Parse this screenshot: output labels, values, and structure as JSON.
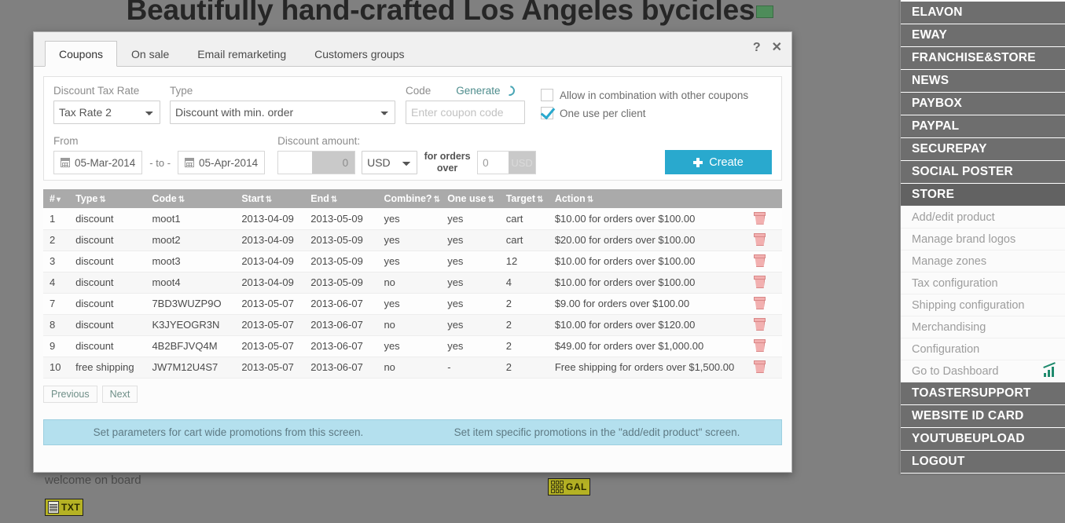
{
  "background": {
    "site_title": "Beautifully hand-crafted Los Angeles bycicles",
    "welcome_text": "welcome on board",
    "txt_badge_label": "TXT",
    "gal_badge_label": "GAL"
  },
  "sidebar": {
    "items": [
      {
        "label": "ELAVON",
        "active": false
      },
      {
        "label": "EWAY",
        "active": false
      },
      {
        "label": "FRANCHISE&STORE",
        "active": false
      },
      {
        "label": "NEWS",
        "active": false
      },
      {
        "label": "PAYBOX",
        "active": false
      },
      {
        "label": "PAYPAL",
        "active": false
      },
      {
        "label": "SECUREPAY",
        "active": false
      },
      {
        "label": "SOCIAL POSTER",
        "active": false
      },
      {
        "label": "STORE",
        "active": true
      }
    ],
    "store_submenu": [
      {
        "label": "Add/edit product",
        "icon": ""
      },
      {
        "label": "Manage brand logos",
        "icon": ""
      },
      {
        "label": "Manage zones",
        "icon": ""
      },
      {
        "label": "Tax configuration",
        "icon": ""
      },
      {
        "label": "Shipping configuration",
        "icon": ""
      },
      {
        "label": "Merchandising",
        "icon": ""
      },
      {
        "label": "Configuration",
        "icon": ""
      },
      {
        "label": "Go to Dashboard",
        "icon": "chart-icon"
      }
    ],
    "items_after": [
      {
        "label": "TOASTERSUPPORT"
      },
      {
        "label": "WEBSITE ID CARD"
      },
      {
        "label": "YOUTUBEUPLOAD"
      },
      {
        "label": "LOGOUT"
      }
    ]
  },
  "modal": {
    "tabs": [
      {
        "label": "Coupons",
        "active": true
      },
      {
        "label": "On sale",
        "active": false
      },
      {
        "label": "Email remarketing",
        "active": false
      },
      {
        "label": "Customers groups",
        "active": false
      }
    ],
    "help_icon": "?",
    "close_icon": "✕"
  },
  "form": {
    "discount_tax_rate_label": "Discount Tax Rate",
    "discount_tax_rate_value": "Tax Rate 2",
    "discount_tax_rate_options": [
      "Tax Rate 2"
    ],
    "type_label": "Type",
    "type_value": "Discount with min. order",
    "type_options": [
      "Discount with min. order"
    ],
    "code_label": "Code",
    "generate_label": "Generate",
    "code_placeholder": "Enter coupon code",
    "code_value": "",
    "allow_combination_label": "Allow in combination with other coupons",
    "allow_combination_checked": false,
    "one_use_label": "One use per client",
    "one_use_checked": true,
    "from_label": "From",
    "from_date": "05-Mar-2014",
    "to_separator": "- to -",
    "to_date": "05-Apr-2014",
    "discount_amount_label": "Discount amount:",
    "discount_amount_value": "0",
    "currency_value": "USD",
    "currency_options": [
      "USD"
    ],
    "for_orders_over_label": "for orders over",
    "orders_over_value": "0",
    "orders_over_currency": "USD",
    "create_label": "Create",
    "create_color": "#29a9ce"
  },
  "table": {
    "columns": [
      "#",
      "Type",
      "Code",
      "Start",
      "End",
      "Combine?",
      "One use",
      "Target",
      "Action"
    ],
    "rows": [
      {
        "num": "1",
        "type": "discount",
        "code": "moot1",
        "start": "2013-04-09",
        "end": "2013-05-09",
        "combine": "yes",
        "one_use": "yes",
        "target": "cart",
        "target_is_num": false,
        "action": "$10.00 for orders over $100.00"
      },
      {
        "num": "2",
        "type": "discount",
        "code": "moot2",
        "start": "2013-04-09",
        "end": "2013-05-09",
        "combine": "yes",
        "one_use": "yes",
        "target": "cart",
        "target_is_num": false,
        "action": "$20.00 for orders over $100.00"
      },
      {
        "num": "3",
        "type": "discount",
        "code": "moot3",
        "start": "2013-04-09",
        "end": "2013-05-09",
        "combine": "yes",
        "one_use": "yes",
        "target": "12",
        "target_is_num": true,
        "action": "$10.00 for orders over $100.00"
      },
      {
        "num": "4",
        "type": "discount",
        "code": "moot4",
        "start": "2013-04-09",
        "end": "2013-05-09",
        "combine": "no",
        "one_use": "yes",
        "target": "4",
        "target_is_num": true,
        "action": "$10.00 for orders over $100.00"
      },
      {
        "num": "7",
        "type": "discount",
        "code": "7BD3WUZP9O",
        "start": "2013-05-07",
        "end": "2013-06-07",
        "combine": "yes",
        "one_use": "yes",
        "target": "2",
        "target_is_num": true,
        "action": "$9.00 for orders over $100.00"
      },
      {
        "num": "8",
        "type": "discount",
        "code": "K3JYEOGR3N",
        "start": "2013-05-07",
        "end": "2013-06-07",
        "combine": "no",
        "one_use": "yes",
        "target": "2",
        "target_is_num": true,
        "action": "$10.00 for orders over $120.00"
      },
      {
        "num": "9",
        "type": "discount",
        "code": "4B2BFJVQ4M",
        "start": "2013-05-07",
        "end": "2013-06-07",
        "combine": "yes",
        "one_use": "yes",
        "target": "2",
        "target_is_num": true,
        "action": "$49.00 for orders over $1,000.00"
      },
      {
        "num": "10",
        "type": "free shipping",
        "code": "JW7M12U4S7",
        "start": "2013-05-07",
        "end": "2013-06-07",
        "combine": "no",
        "one_use": "-",
        "target": "2",
        "target_is_num": true,
        "action": "Free shipping for orders over $1,500.00"
      }
    ],
    "delete_icon": "trash-icon"
  },
  "pager": {
    "previous_label": "Previous",
    "next_label": "Next"
  },
  "info_bar": {
    "left_text": "Set parameters for cart wide promotions from this screen.",
    "right_text": "Set item specific promotions in the \"add/edit product\" screen.",
    "bg_color": "#b4e0ee"
  }
}
